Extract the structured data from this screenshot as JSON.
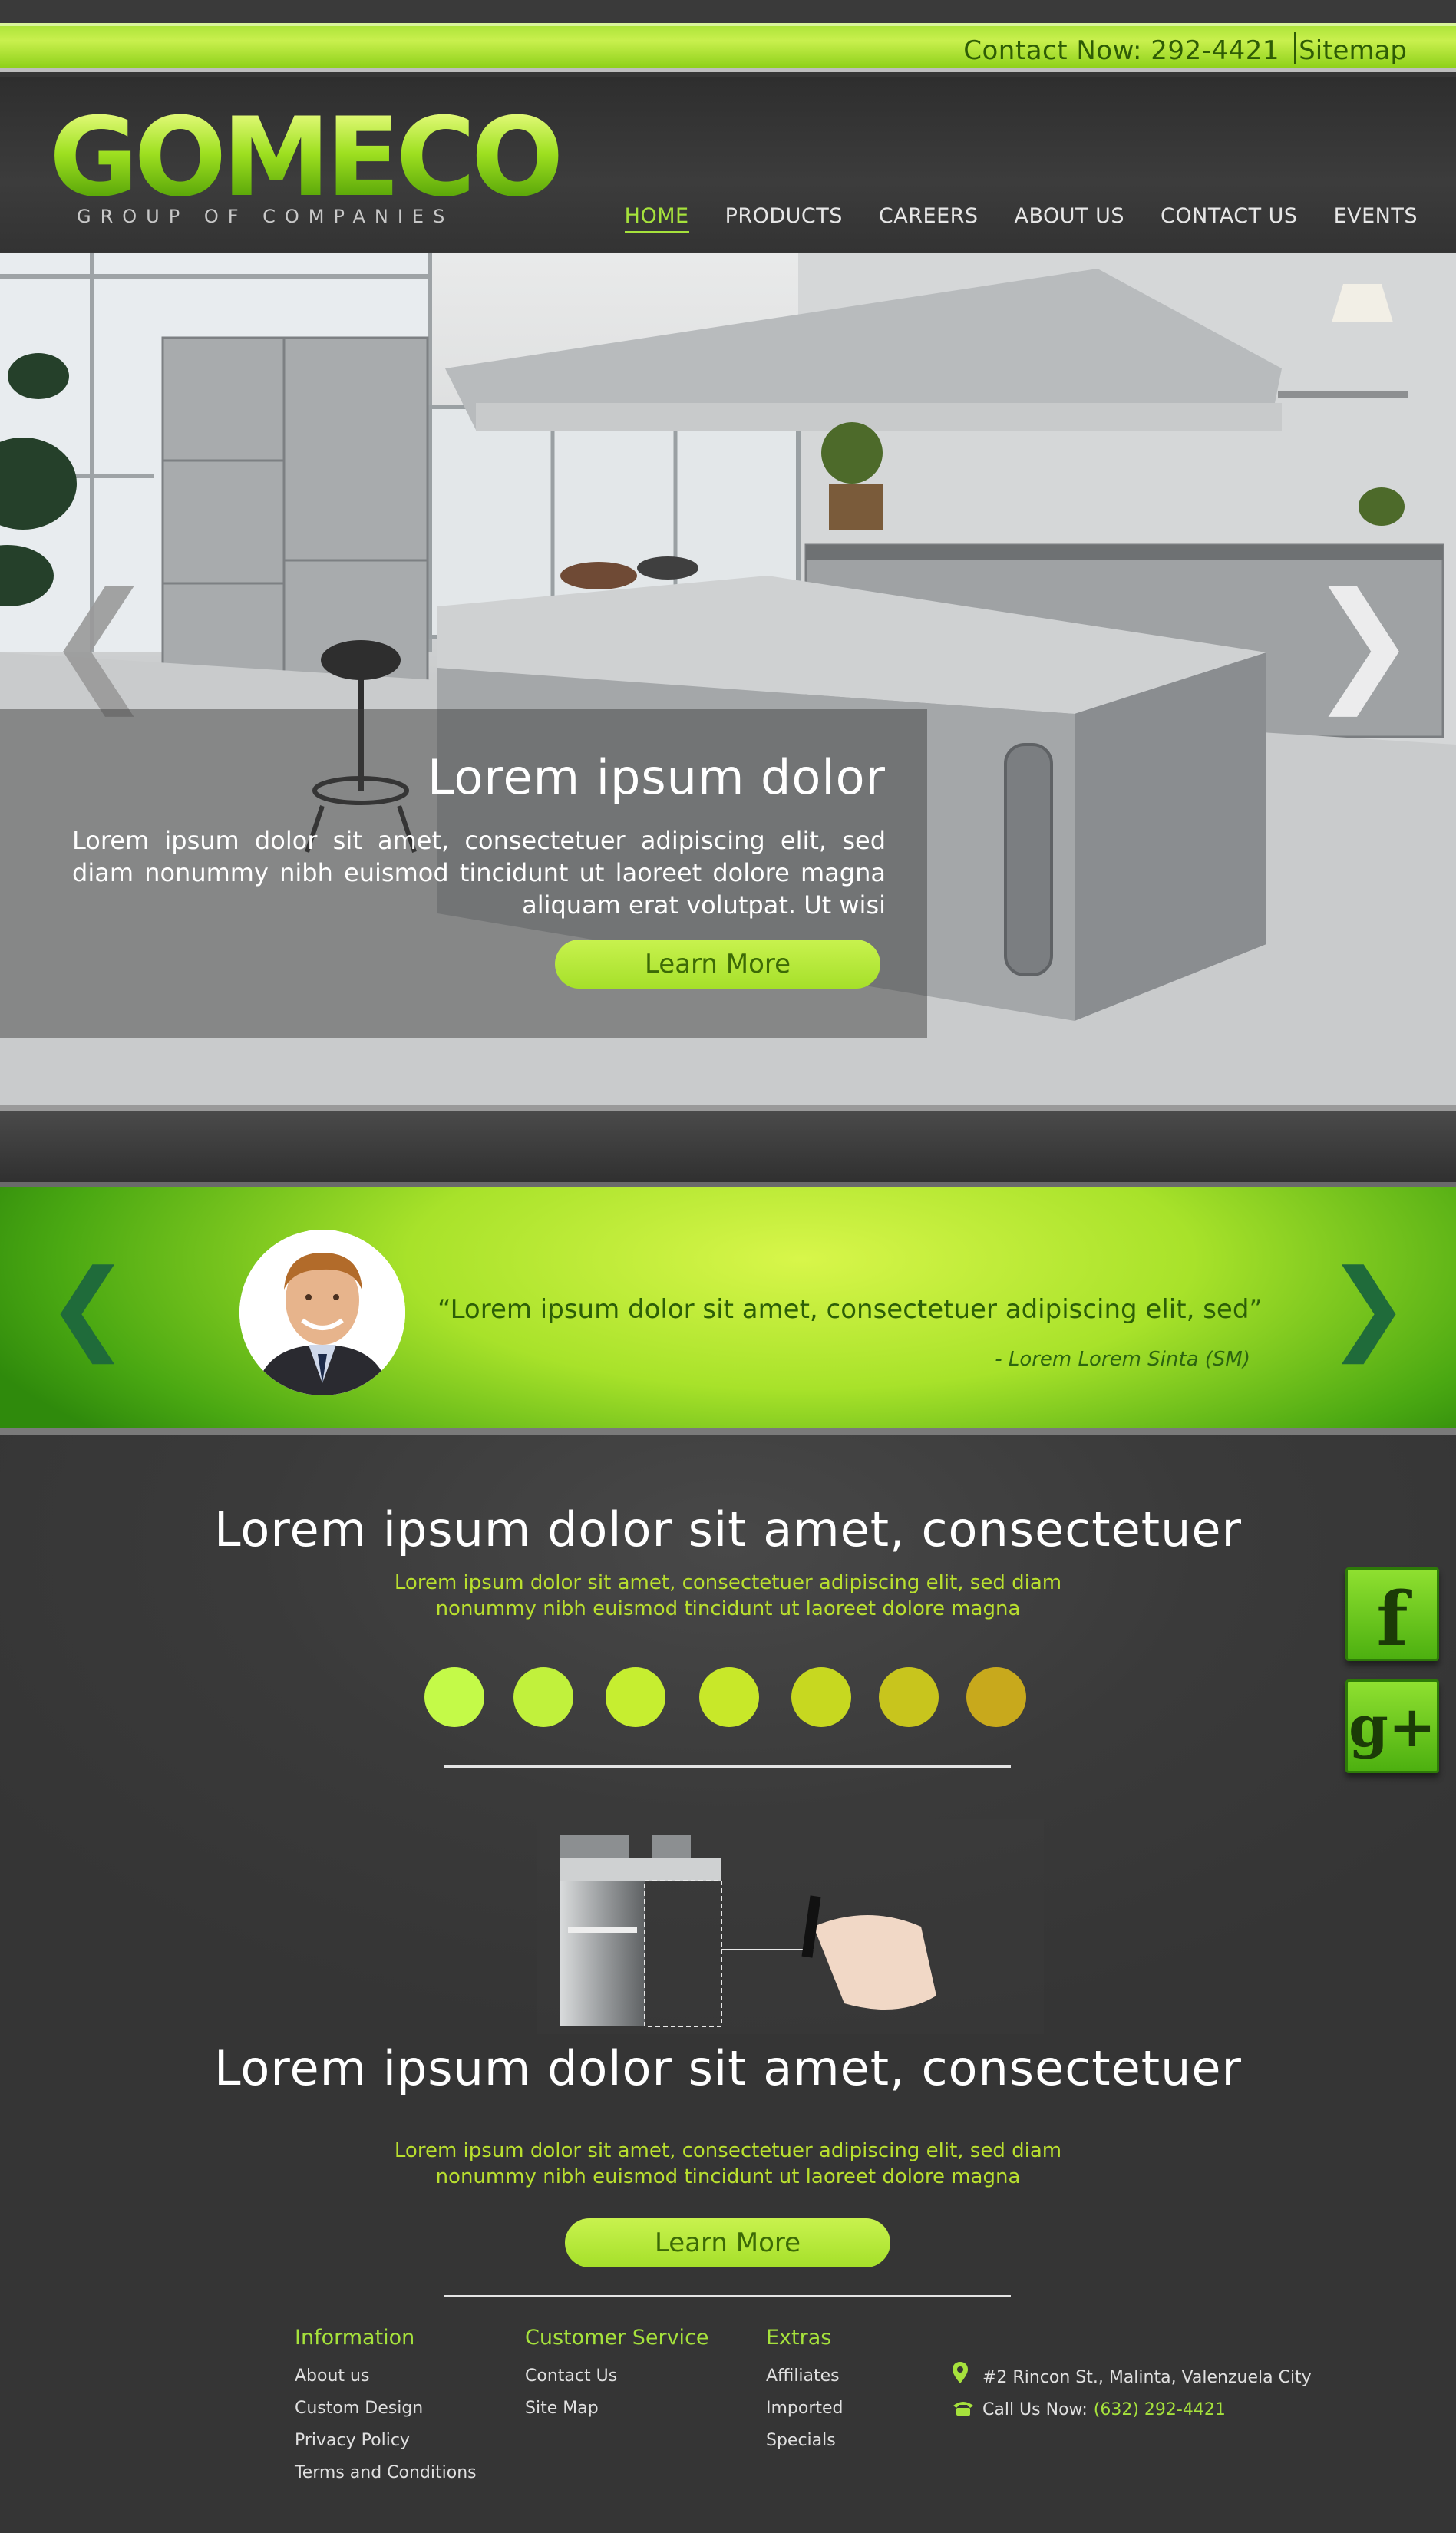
{
  "topbar": {
    "contact": "Contact Now: 292-4421",
    "sitemap": "Sitemap"
  },
  "brand": {
    "name": "GOMECO",
    "tagline": "GROUP OF COMPANIES"
  },
  "nav": {
    "items": [
      "HOME",
      "PRODUCTS",
      "CAREERS",
      "ABOUT US",
      "CONTACT US",
      "EVENTS"
    ],
    "active": "HOME"
  },
  "hero": {
    "title": "Lorem ipsum dolor",
    "body": "Lorem ipsum dolor sit amet, consectetuer adipiscing elit, sed diam nonummy nibh euismod tincidunt ut laoreet dolore magna aliquam erat volutpat. Ut wisi",
    "button": "Learn More",
    "prev_icon": "❮",
    "next_icon": "❯"
  },
  "testimonial": {
    "quote": "“Lorem ipsum dolor sit amet, consectetuer adipiscing elit, sed”",
    "author": "- Lorem Lorem Sinta (SM)",
    "prev_icon": "❮",
    "next_icon": "❯"
  },
  "section1": {
    "title": "Lorem ipsum dolor sit amet, consectetuer",
    "line1": "Lorem ipsum dolor sit amet, consectetuer adipiscing elit, sed diam",
    "line2": "nonummy nibh euismod tincidunt ut laoreet dolore magna",
    "dot_colors": [
      "#c4fa48",
      "#c1f13c",
      "#c6ee30",
      "#c8e829",
      "#c7d820",
      "#c8c51d",
      "#c8a91c"
    ]
  },
  "section2": {
    "title": "Lorem ipsum dolor sit amet, consectetuer",
    "line1": "Lorem ipsum dolor sit amet, consectetuer adipiscing elit, sed diam",
    "line2": "nonummy nibh euismod tincidunt ut laoreet dolore magna",
    "button": "Learn More"
  },
  "social": {
    "facebook_glyph": "f",
    "google_glyph": "g+"
  },
  "footer": {
    "information": {
      "heading": "Information",
      "links": [
        "About us",
        "Custom Design",
        "Privacy Policy",
        "Terms and Conditions"
      ]
    },
    "customer_service": {
      "heading": "Customer Service",
      "links": [
        "Contact Us",
        "Site Map"
      ]
    },
    "extras": {
      "heading": "Extras",
      "links": [
        "Affiliates",
        "Imported",
        "Specials"
      ]
    },
    "address": "#2 Rincon St., Malinta, Valenzuela City",
    "call_label": "Call Us Now:",
    "phone": "(632) 292-4421"
  },
  "colors": {
    "accent_green": "#a6e23c",
    "dark_green": "#2c5f07",
    "background": "#363636"
  }
}
